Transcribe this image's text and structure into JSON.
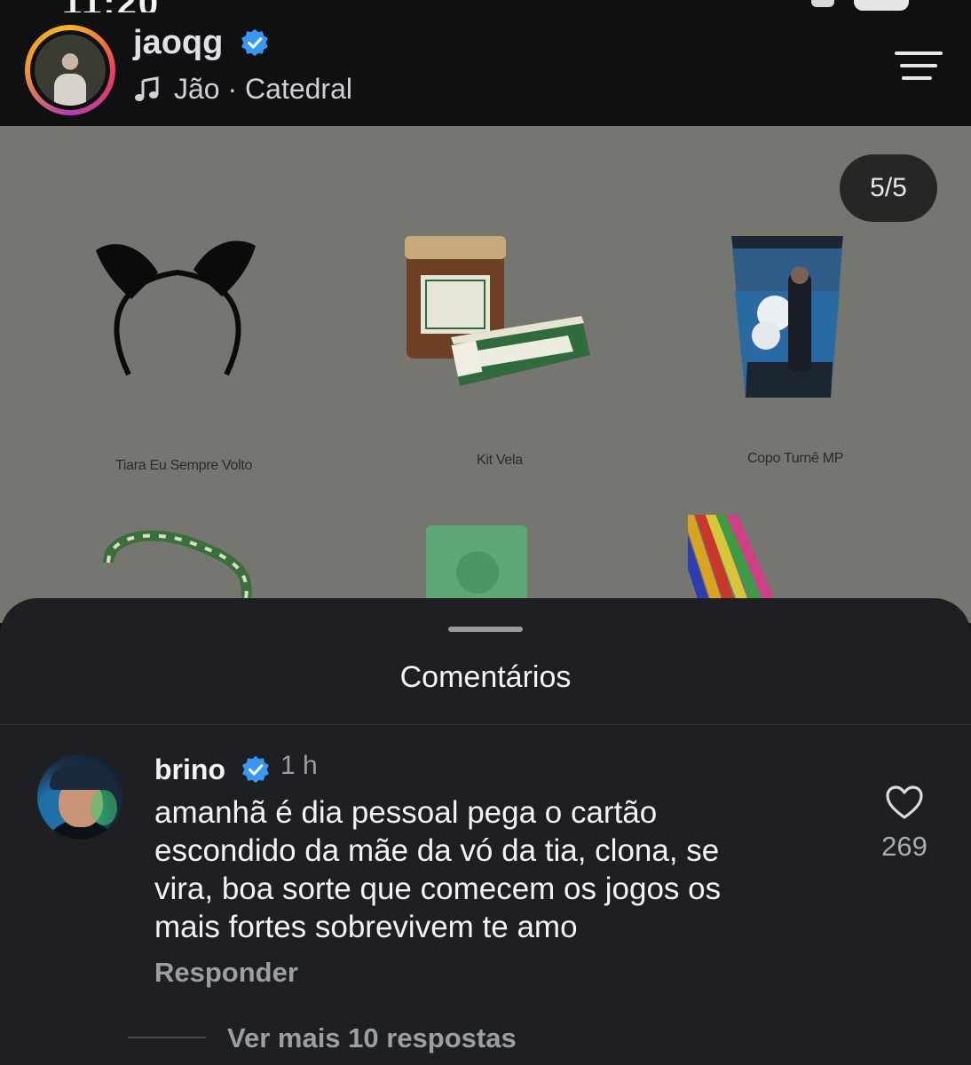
{
  "status_bar": {
    "time_partial": "11:20"
  },
  "header": {
    "username": "jaoqg",
    "verified": true,
    "music": "Jão · Catedral",
    "icons": [
      "music-note-icon",
      "menu-icon",
      "verified-icon"
    ]
  },
  "post": {
    "counter": "5/5",
    "products": [
      {
        "label": "Tiara Eu Sempre Volto"
      },
      {
        "label": "Kit Vela"
      },
      {
        "label": "Copo Turnê MP"
      }
    ]
  },
  "comments_sheet": {
    "title": "Comentários",
    "comment": {
      "username": "brino",
      "verified": true,
      "time": "1 h",
      "lines": [
        "amanhã é dia pessoal pega o cartão",
        "escondido da mãe da vó da tia, clona, se",
        "vira, boa sorte que comecem os jogos os",
        "mais fortes sobrevivem te amo"
      ],
      "likes": "269",
      "reply_label": "Responder",
      "more_replies_label": "Ver mais 10 respostas"
    }
  },
  "colors": {
    "header_bg": "#0f1012",
    "post_bg": "#767670",
    "sheet_bg": "#1e1f22",
    "verified_blue": "#3897f0"
  }
}
